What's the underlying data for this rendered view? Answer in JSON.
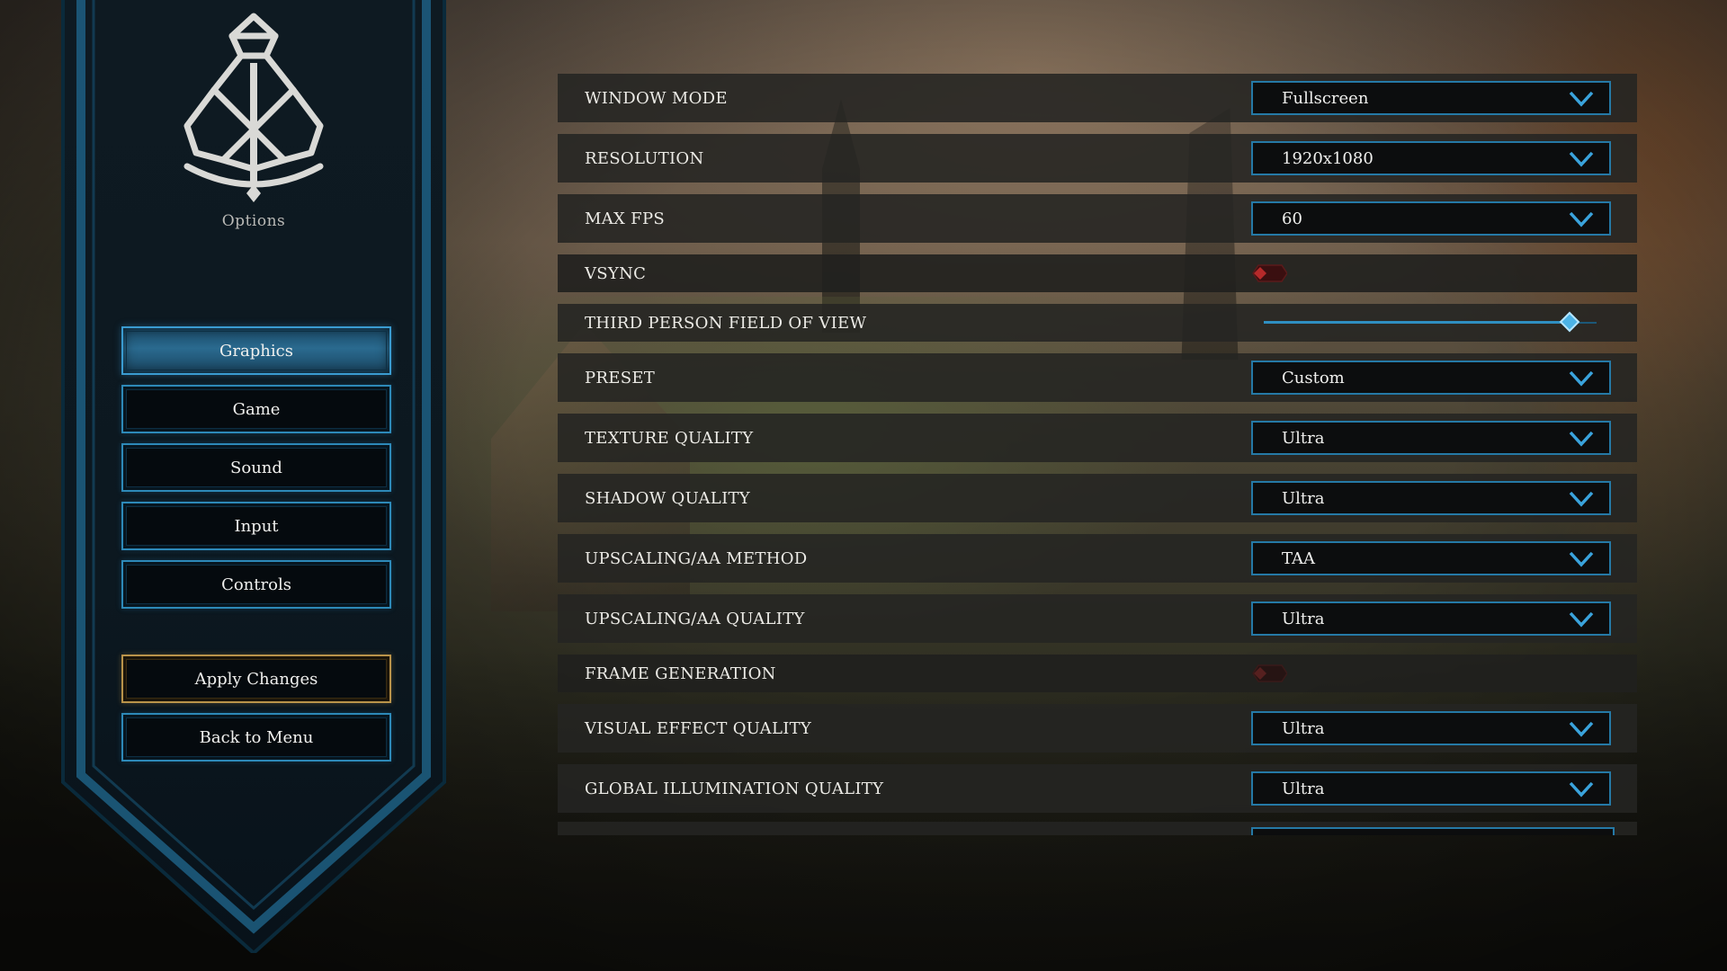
{
  "sidebar": {
    "title": "Options",
    "tabs": [
      {
        "label": "Graphics",
        "active": true
      },
      {
        "label": "Game",
        "active": false
      },
      {
        "label": "Sound",
        "active": false
      },
      {
        "label": "Input",
        "active": false
      },
      {
        "label": "Controls",
        "active": false
      }
    ],
    "apply_label": "Apply Changes",
    "back_label": "Back to Menu"
  },
  "settings": {
    "window_mode": {
      "label": "WINDOW MODE",
      "value": "Fullscreen"
    },
    "resolution": {
      "label": "RESOLUTION",
      "value": "1920x1080"
    },
    "max_fps": {
      "label": "MAX FPS",
      "value": "60"
    },
    "vsync": {
      "label": "VSYNC",
      "enabled": false
    },
    "fov": {
      "label": "THIRD PERSON FIELD OF VIEW",
      "level": 0.92
    },
    "preset": {
      "label": "PRESET",
      "value": "Custom"
    },
    "texture_quality": {
      "label": "TEXTURE QUALITY",
      "value": "Ultra"
    },
    "shadow_quality": {
      "label": "SHADOW QUALITY",
      "value": "Ultra"
    },
    "aa_method": {
      "label": "UPSCALING/AA METHOD",
      "value": "TAA"
    },
    "aa_quality": {
      "label": "UPSCALING/AA QUALITY",
      "value": "Ultra"
    },
    "frame_generation": {
      "label": "FRAME GENERATION",
      "enabled": false
    },
    "visual_effect_quality": {
      "label": "VISUAL EFFECT QUALITY",
      "value": "Ultra"
    },
    "gi_quality": {
      "label": "GLOBAL ILLUMINATION QUALITY",
      "value": "Ultra"
    }
  },
  "colors": {
    "accent": "#2f8fc1",
    "apply_border": "#b9934a",
    "toggle_off": "#a02a2a"
  },
  "icons": {
    "dropdown": "chevron-down-icon",
    "logo": "knot-sword-emblem"
  }
}
